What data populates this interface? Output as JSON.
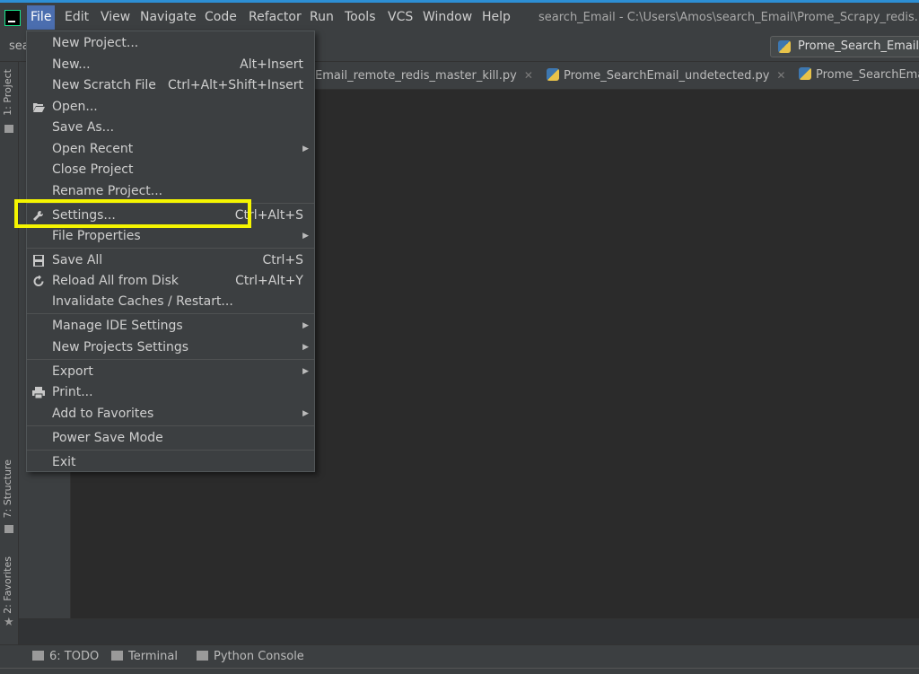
{
  "app": {
    "window_title": "search_Email - C:\\Users\\Amos\\search_Email\\Prome_Scrapy_redis.py",
    "accent_color": "#4b6eaf",
    "highlight_color": "#f5f500",
    "app_icon": "pycharm-logo-icon"
  },
  "menubar": [
    {
      "label": "File",
      "active": true
    },
    {
      "label": "Edit"
    },
    {
      "label": "View"
    },
    {
      "label": "Navigate"
    },
    {
      "label": "Code"
    },
    {
      "label": "Refactor"
    },
    {
      "label": "Run"
    },
    {
      "label": "Tools"
    },
    {
      "label": "VCS"
    },
    {
      "label": "Window"
    },
    {
      "label": "Help"
    }
  ],
  "navbar": {
    "breadcrumb": "sea",
    "run_config": "Prome_Search_Email"
  },
  "left_tools": {
    "project": "1: Project",
    "structure": "7: Structure",
    "favorites": "2: Favorites"
  },
  "tabs": [
    {
      "label": "Email_remote_redis_master_kill.py"
    },
    {
      "label": "Prome_SearchEmail_undetected.py"
    },
    {
      "label": "Prome_SearchEma"
    }
  ],
  "bottom_tools": [
    {
      "label": "6: TODO",
      "icon": "todo-list-icon"
    },
    {
      "label": "Terminal",
      "icon": "terminal-icon"
    },
    {
      "label": "Python Console",
      "icon": "python-icon"
    }
  ],
  "file_menu": {
    "items": [
      {
        "label": "New Project...",
        "shortcut": ""
      },
      {
        "label": "New...",
        "shortcut": "Alt+Insert"
      },
      {
        "label": "New Scratch File",
        "shortcut": "Ctrl+Alt+Shift+Insert"
      },
      {
        "label": "Open...",
        "shortcut": "",
        "icon": "folder-open-icon"
      },
      {
        "label": "Save As...",
        "shortcut": ""
      },
      {
        "label": "Open Recent",
        "shortcut": "",
        "submenu": true
      },
      {
        "label": "Close Project",
        "shortcut": ""
      },
      {
        "label": "Rename Project...",
        "shortcut": ""
      },
      {
        "label": "Settings...",
        "shortcut": "Ctrl+Alt+S",
        "icon": "wrench-icon",
        "highlighted": true
      },
      {
        "label": "File Properties",
        "shortcut": "",
        "submenu": true
      },
      {
        "label": "Save All",
        "shortcut": "Ctrl+S",
        "icon": "save-icon"
      },
      {
        "label": "Reload All from Disk",
        "shortcut": "Ctrl+Alt+Y",
        "icon": "reload-icon"
      },
      {
        "label": "Invalidate Caches / Restart...",
        "shortcut": ""
      },
      {
        "label": "Manage IDE Settings",
        "shortcut": "",
        "submenu": true
      },
      {
        "label": "New Projects Settings",
        "shortcut": "",
        "submenu": true
      },
      {
        "label": "Export",
        "shortcut": "",
        "submenu": true
      },
      {
        "label": "Print...",
        "shortcut": "",
        "icon": "printer-icon"
      },
      {
        "label": "Add to Favorites",
        "shortcut": "",
        "submenu": true
      },
      {
        "label": "Power Save Mode",
        "shortcut": ""
      },
      {
        "label": "Exit",
        "shortcut": ""
      }
    ]
  }
}
